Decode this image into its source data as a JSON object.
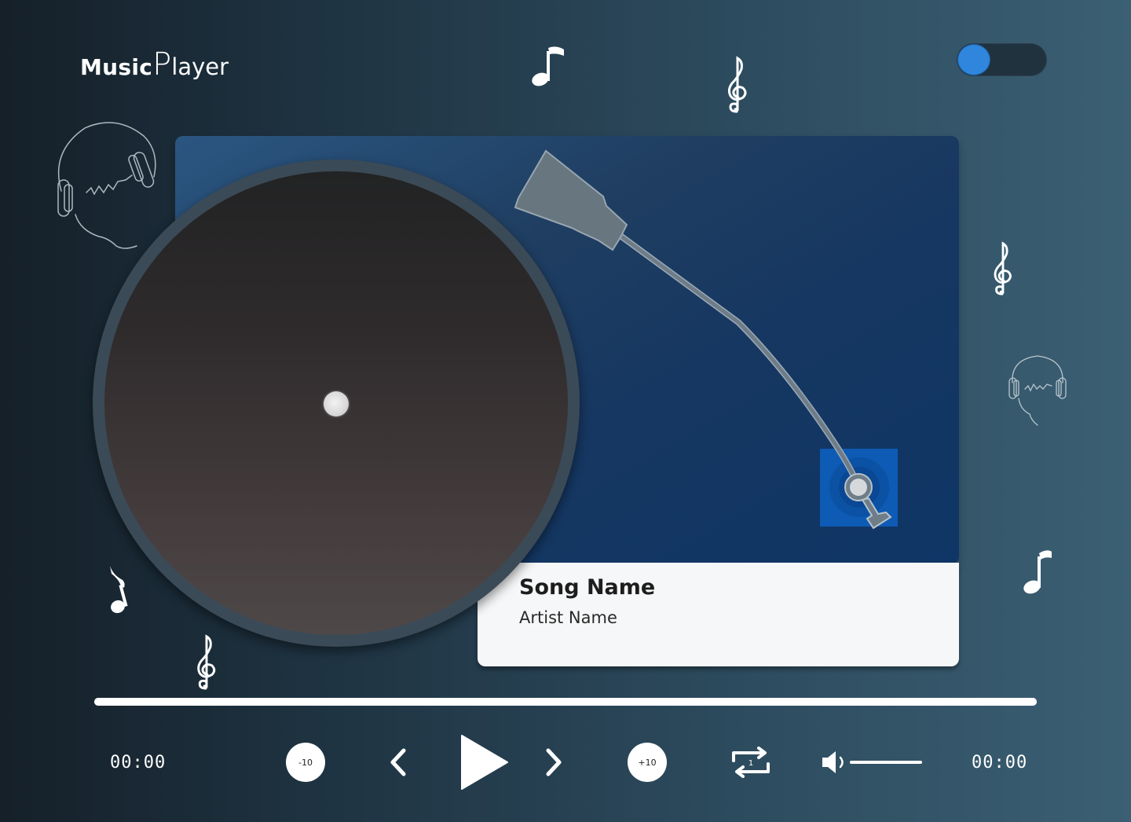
{
  "app": {
    "logo_part1": "Music",
    "logo_part2": "P",
    "logo_part3": "layer"
  },
  "theme_toggle": {
    "state": "on",
    "accent": "#2f86dc"
  },
  "track": {
    "title": "Song Name",
    "artist": "Artist Name"
  },
  "playback": {
    "current_time": "00:00",
    "total_time": "00:00",
    "progress": 1.0,
    "rewind_label": "-10",
    "forward_label": "+10",
    "repeat_count": "1",
    "volume": 1.0
  },
  "icons": {
    "prev": "chevron-left-icon",
    "play": "play-icon",
    "next": "chevron-right-icon",
    "repeat": "repeat-icon",
    "volume": "volume-icon"
  },
  "colors": {
    "card_top": "#1f3e61",
    "card_bottom": "#f6f7f8",
    "record_rim": "#3b4a57",
    "tonearm_base": "#0d5bb5"
  }
}
